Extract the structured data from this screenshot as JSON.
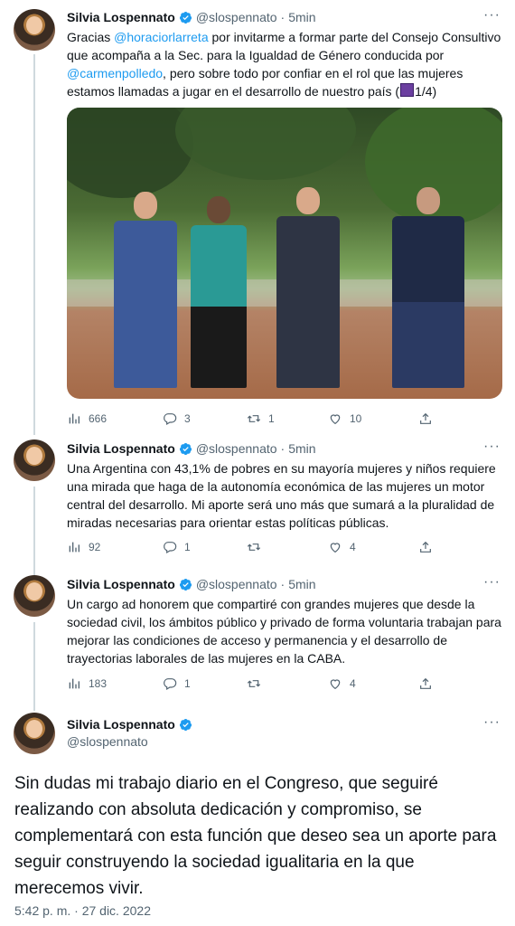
{
  "author": {
    "name": "Silvia Lospennato",
    "handle": "@slospennato"
  },
  "colors": {
    "accent": "#1d9bf0",
    "text": "#0f1419",
    "muted": "#536471",
    "line": "#cfd9de"
  },
  "tweets": [
    {
      "time": "5min",
      "text": [
        {
          "t": "Gracias "
        },
        {
          "t": "@horaciorlarreta",
          "mention": true
        },
        {
          "t": " por invitarme a formar parte del Consejo Consultivo que acompaña a la Sec. para la Igualdad de Género conducida por "
        },
        {
          "t": "@carmenpolledo",
          "mention": true
        },
        {
          "t": ", pero sobre todo por confiar en el rol que las mujeres estamos llamadas a jugar en el desarrollo de nuestro país ("
        },
        {
          "t": "",
          "emoji": "purple-square"
        },
        {
          "t": "1/4)"
        }
      ],
      "stats": {
        "views": "666",
        "replies": "3",
        "retweets": "1",
        "likes": "10"
      }
    },
    {
      "time": "5min",
      "text": [
        {
          "t": "Una Argentina con 43,1% de pobres en su mayoría mujeres y niños requiere una mirada que haga de la autonomía económica de las mujeres un motor central del desarrollo. Mi aporte será uno más que sumará a la pluralidad de miradas necesarias para orientar estas políticas públicas."
        }
      ],
      "stats": {
        "views": "92",
        "replies": "1",
        "retweets": "",
        "likes": "4"
      }
    },
    {
      "time": "5min",
      "text": [
        {
          "t": "Un cargo ad honorem que compartiré con grandes mujeres que desde la sociedad civil, los ámbitos público y privado de forma voluntaria trabajan para mejorar las condiciones de acceso y permanencia y el desarrollo de trayectorias laborales de las mujeres en la CABA."
        }
      ],
      "stats": {
        "views": "183",
        "replies": "1",
        "retweets": "",
        "likes": "4"
      }
    }
  ],
  "focus": {
    "text": "Sin dudas mi trabajo diario en el Congreso, que seguiré realizando con absoluta dedicación y compromiso, se complementará con esta función que deseo sea un aporte para seguir construyendo la sociedad igualitaria en la que merecemos vivir.",
    "timestamp": "5:42 p. m. · 27 dic. 2022"
  },
  "icons": {
    "views": "bar-chart-icon",
    "reply": "reply-icon",
    "retweet": "retweet-icon",
    "like": "heart-icon",
    "share": "share-icon",
    "more": "more-icon",
    "verified": "verified-badge-icon"
  },
  "more_glyph": "···"
}
